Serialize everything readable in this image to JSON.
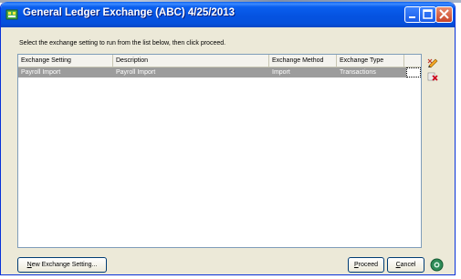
{
  "window": {
    "title": "General Ledger Exchange (ABC) 4/25/2013",
    "title_color": "#0553e1"
  },
  "instruction": "Select the exchange setting to run from the list below, then click proceed.",
  "grid": {
    "columns": [
      "Exchange Setting",
      "Description",
      "Exchange Method",
      "Exchange Type"
    ],
    "rows": [
      {
        "setting": "Payroll Import",
        "description": "Payroll Import",
        "method": "Import",
        "type": "Transactions",
        "selected": true
      }
    ]
  },
  "side_icons": [
    "edit-setting-icon",
    "delete-setting-icon"
  ],
  "buttons": {
    "new_setting_first": "N",
    "new_setting_rest": "ew Exchange Setting...",
    "proceed_first": "P",
    "proceed_rest": "roceed",
    "cancel_first": "C",
    "cancel_rest": "ancel"
  },
  "help_icon": "help-icon"
}
